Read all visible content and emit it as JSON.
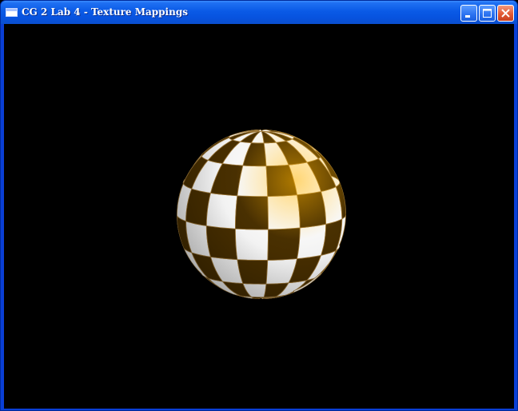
{
  "window": {
    "title": "CG 2 Lab 4 - Texture Mappings",
    "title_bar_color": "#0a5ae6",
    "icons": {
      "app": "window-icon",
      "minimize": "minimize-icon",
      "maximize": "maximize-icon",
      "close": "close-icon"
    }
  },
  "viewport": {
    "background": "#000000",
    "sphere": {
      "texture": "checkerboard",
      "light_color": "#ffffff",
      "dark_color": "#4a3000",
      "highlight_color": "#ffb400"
    }
  }
}
